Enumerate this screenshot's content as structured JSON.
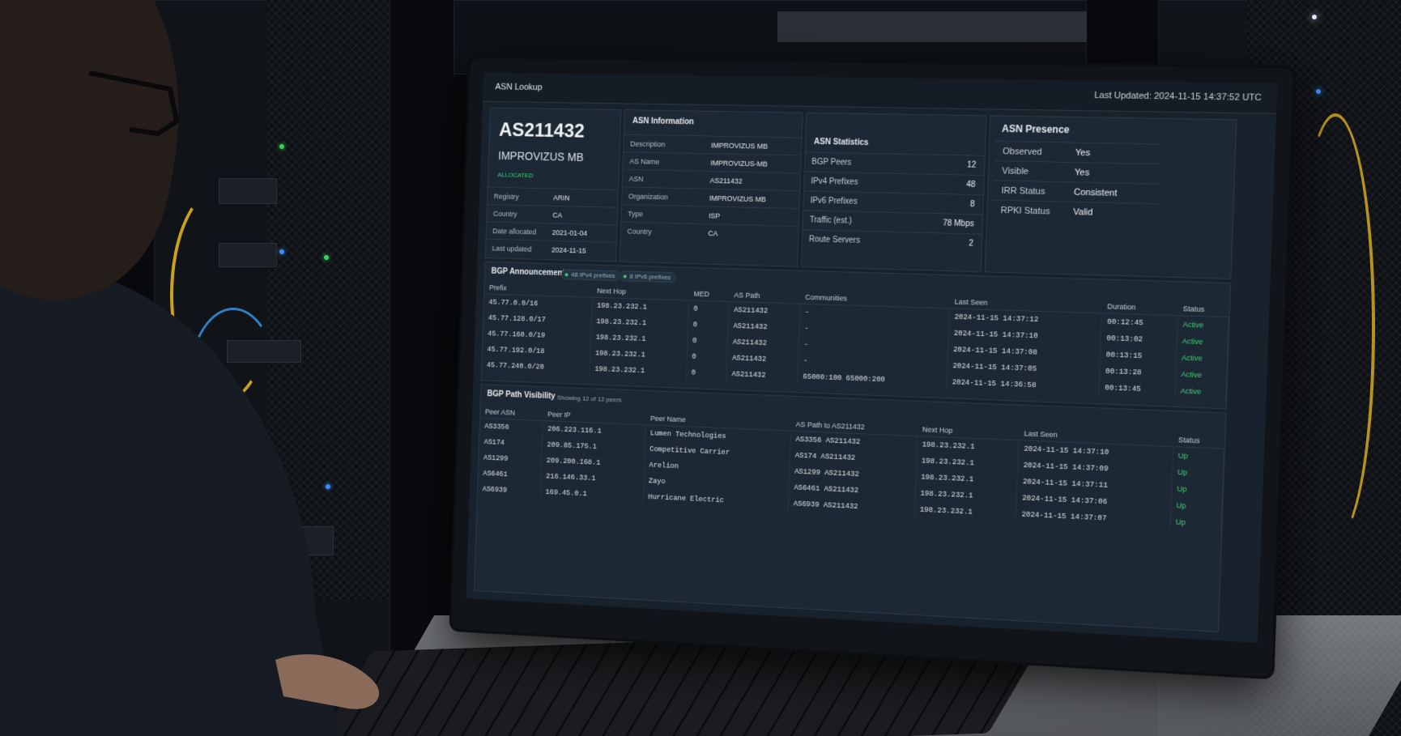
{
  "header": {
    "title": "ASN Lookup",
    "last_updated": "Last Updated: 2024-11-15 14:37:52 UTC"
  },
  "asn_card": {
    "asn": "AS211432",
    "name": "IMPROVIZUS MB",
    "status": "ALLOCATED",
    "rows": [
      {
        "k": "Registry",
        "v": "ARIN"
      },
      {
        "k": "Country",
        "v": "CA"
      },
      {
        "k": "Date allocated",
        "v": "2021-01-04"
      },
      {
        "k": "Last updated",
        "v": "2024-11-15"
      }
    ]
  },
  "asn_information": {
    "title": "ASN Information",
    "rows": [
      {
        "k": "Description",
        "v": "IMPROVIZUS MB"
      },
      {
        "k": "AS Name",
        "v": "IMPROVIZUS-MB"
      },
      {
        "k": "ASN",
        "v": "AS211432"
      },
      {
        "k": "Organization",
        "v": "IMPROVIZUS MB"
      },
      {
        "k": "Type",
        "v": "ISP"
      },
      {
        "k": "Country",
        "v": "CA"
      }
    ]
  },
  "asn_statistics": {
    "title": "ASN Statistics",
    "rows": [
      {
        "k": "BGP Peers",
        "v": "12"
      },
      {
        "k": "IPv4 Prefixes",
        "v": "48"
      },
      {
        "k": "IPv6 Prefixes",
        "v": "8"
      },
      {
        "k": "Traffic (est.)",
        "v": "78 Mbps"
      },
      {
        "k": "Route Servers",
        "v": "2"
      }
    ]
  },
  "asn_presence": {
    "title": "ASN Presence",
    "rows": [
      {
        "k": "Observed",
        "v": "Yes"
      },
      {
        "k": "Visible",
        "v": "Yes"
      },
      {
        "k": "IRR Status",
        "v": "Consistent"
      },
      {
        "k": "RPKI Status",
        "v": "Valid"
      }
    ]
  },
  "bgp_announcements": {
    "title": "BGP Announcements",
    "badge_v4": "48 IPv4 prefixes",
    "badge_v6": "8 IPv6 prefixes",
    "columns": [
      "Prefix",
      "Next Hop",
      "MED",
      "AS Path",
      "Communities",
      "Last Seen",
      "Duration",
      "Status"
    ],
    "rows": [
      [
        "45.77.0.0/16",
        "198.23.232.1",
        "0",
        "AS211432",
        "-",
        "2024-11-15 14:37:12",
        "00:12:45",
        "Active"
      ],
      [
        "45.77.128.0/17",
        "198.23.232.1",
        "0",
        "AS211432",
        "-",
        "2024-11-15 14:37:10",
        "00:13:02",
        "Active"
      ],
      [
        "45.77.160.0/19",
        "198.23.232.1",
        "0",
        "AS211432",
        "-",
        "2024-11-15 14:37:08",
        "00:13:15",
        "Active"
      ],
      [
        "45.77.192.0/18",
        "198.23.232.1",
        "0",
        "AS211432",
        "-",
        "2024-11-15 14:37:05",
        "00:13:28",
        "Active"
      ],
      [
        "45.77.240.0/20",
        "198.23.232.1",
        "0",
        "AS211432",
        "65000:100  65000:200",
        "2024-11-15 14:36:58",
        "00:13:45",
        "Active"
      ]
    ]
  },
  "bgp_path_visibility": {
    "title": "BGP Path Visibility",
    "showing": "Showing 12 of 12 peers",
    "columns": [
      "Peer ASN",
      "Peer IP",
      "Peer Name",
      "AS Path to AS211432",
      "Next Hop",
      "Last Seen",
      "Status"
    ],
    "rows": [
      [
        "AS3356",
        "206.223.116.1",
        "Lumen Technologies",
        "AS3356  AS211432",
        "198.23.232.1",
        "2024-11-15 14:37:10",
        "Up"
      ],
      [
        "AS174",
        "209.85.175.1",
        "Competitive Carrier",
        "AS174  AS211432",
        "198.23.232.1",
        "2024-11-15 14:37:09",
        "Up"
      ],
      [
        "AS1299",
        "209.200.168.1",
        "Arelion",
        "AS1299  AS211432",
        "198.23.232.1",
        "2024-11-15 14:37:11",
        "Up"
      ],
      [
        "AS6461",
        "216.146.33.1",
        "Zayo",
        "AS6461  AS211432",
        "198.23.232.1",
        "2024-11-15 14:37:06",
        "Up"
      ],
      [
        "AS6939",
        "169.45.0.1",
        "Hurricane Electric",
        "AS6939  AS211432",
        "198.23.232.1",
        "2024-11-15 14:37:07",
        "Up"
      ]
    ]
  },
  "colors": {
    "screen_bg": "#18222c",
    "panel_bg": "#1c2833",
    "status_green": "#43d07a"
  }
}
